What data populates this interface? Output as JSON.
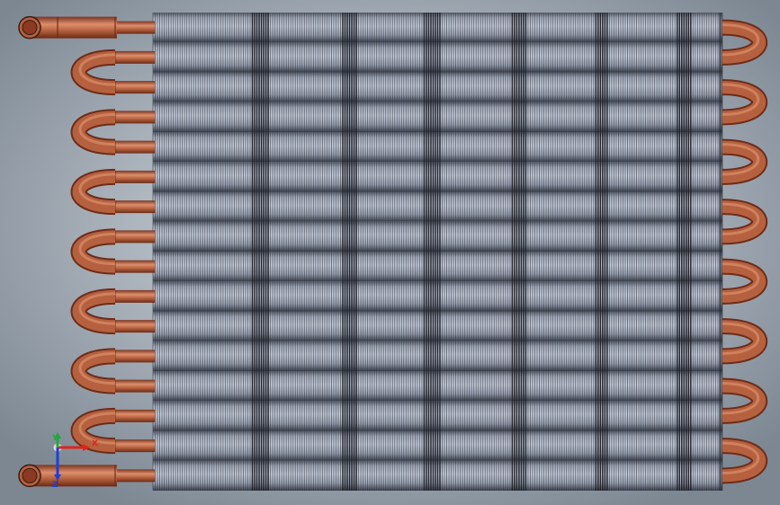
{
  "model": {
    "tube_count": 16,
    "fin_count": 252,
    "colors": {
      "background_center": "#dfe4ea",
      "background_edge": "#7c8792",
      "copper": "#b5613f",
      "copper_highlight": "#dc8e6c",
      "copper_shadow": "#6e2c18",
      "fin_light": "#c6cdd8",
      "fin_dark": "#1c1f25",
      "tube_band": "#8d94a4"
    }
  },
  "triad": {
    "x_label": "X",
    "y_label": "Y",
    "z_label": "Z",
    "x_color": "#e2231a",
    "y_color": "#22a83a",
    "z_color": "#1d3fd8"
  }
}
